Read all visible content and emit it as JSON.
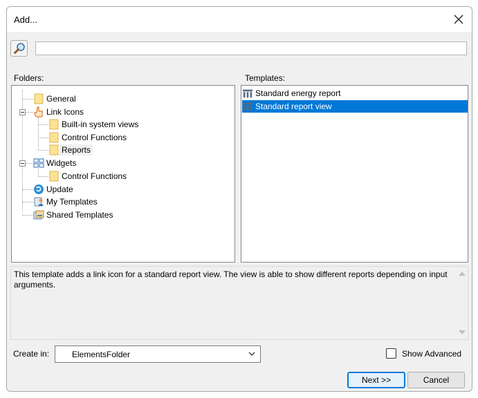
{
  "window": {
    "title": "Add..."
  },
  "search": {
    "value": "",
    "placeholder": ""
  },
  "folders": {
    "label": "Folders:",
    "items": [
      {
        "label": "General",
        "icon": "folder-icon"
      },
      {
        "label": "Link Icons",
        "icon": "hand-pointer-icon"
      },
      {
        "label": "Built-in system views",
        "icon": "folder-icon"
      },
      {
        "label": "Control Functions",
        "icon": "folder-icon"
      },
      {
        "label": "Reports",
        "icon": "folder-icon"
      },
      {
        "label": "Widgets",
        "icon": "widgets-grid-icon"
      },
      {
        "label": "Control Functions",
        "icon": "folder-icon"
      },
      {
        "label": "Update",
        "icon": "update-icon"
      },
      {
        "label": "My Templates",
        "icon": "user-templates-icon"
      },
      {
        "label": "Shared Templates",
        "icon": "shared-templates-icon"
      }
    ],
    "selected": "Reports"
  },
  "templates": {
    "label": "Templates:",
    "items": [
      {
        "label": "Standard energy report",
        "icon": "report-table-icon"
      },
      {
        "label": "Standard report view",
        "icon": "report-table-icon"
      }
    ],
    "selected": "Standard report view"
  },
  "description": "This template adds a link icon for a standard report view. The view is able to show different reports depending on input arguments.",
  "create_in": {
    "label": "Create in:",
    "value": "ElementsFolder"
  },
  "show_advanced": {
    "label": "Show Advanced",
    "checked": false
  },
  "buttons": {
    "next": "Next >>",
    "cancel": "Cancel"
  },
  "colors": {
    "selection": "#0078d7",
    "folder": "#fce293",
    "dialog_bg": "#f0f0f0"
  }
}
